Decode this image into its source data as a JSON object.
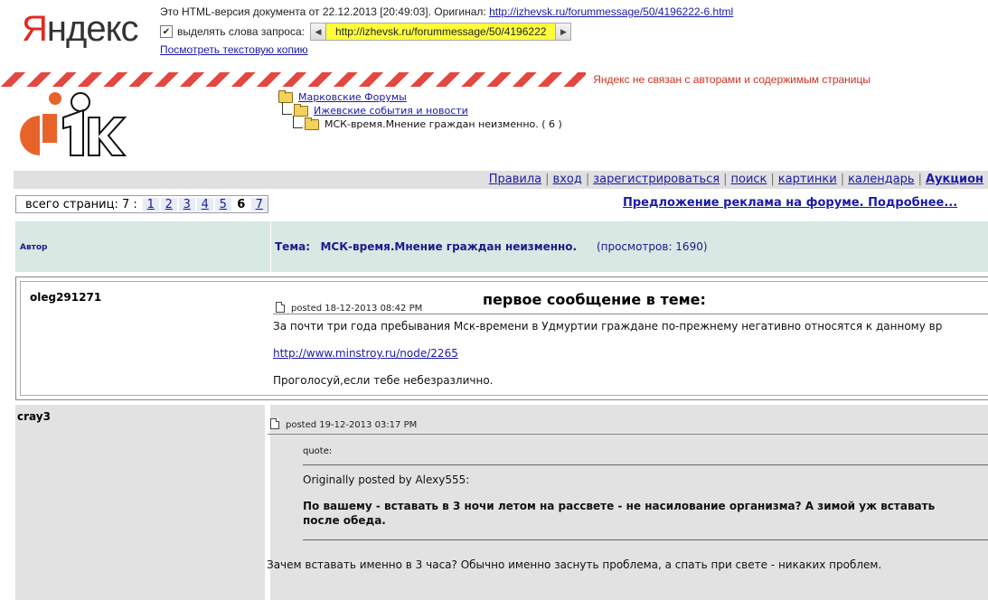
{
  "yandex": {
    "logo_first": "Я",
    "logo_rest": "ндекс",
    "info_prefix": "Это HTML-версия документа от 22.12.2013 [20:49:03]. Оригинал:",
    "original_url": "http://izhevsk.ru/forummessage/50/4196222-6.html",
    "highlight_label": "выделять слова запроса:",
    "highlight_checked": true,
    "query_url": "http://izhevsk.ru/forummessage/50/4196222",
    "text_copy_link": "Посмотреть текстовую копию",
    "disclaimer": "Яндекс не связан с авторами и содержимым страницы",
    "strip_colors": [
      "#ffffff",
      "#e4473f"
    ]
  },
  "breadcrumb": {
    "level1": "Марковские Форумы",
    "level2": "Ижевские события и новости",
    "level3": "МСК-время.Мнение граждан неизменно. ( 6 )"
  },
  "nav": {
    "links": [
      "Правила",
      "вход",
      "зарегистрироваться",
      "поиск",
      "картинки",
      "календарь"
    ],
    "bold_link": "Аукцион"
  },
  "pagination": {
    "label": "всего страниц: 7 :",
    "pages": [
      "1",
      "2",
      "3",
      "4",
      "5",
      "6",
      "7"
    ],
    "current": "6"
  },
  "promo": "Предложение реклама на форуме. Подробнее...",
  "thread": {
    "author_header": "Автор",
    "topic_label": "Тема:",
    "topic_title": "МСК-время.Мнение граждан неизменно.",
    "views": "(просмотров: 1690)"
  },
  "posts": [
    {
      "author": "oleg291271",
      "posted": "posted 18-12-2013 08:42 PM",
      "first_label": "первое сообщение в теме:",
      "body1": "За почти три года пребывания Мск-времени в Удмуртии граждане по-прежнему негативно относятся к данному вр",
      "link": "http://www.minstroy.ru/node/2265",
      "body2": "Проголосуй,если тебе небезразлично."
    },
    {
      "author": "cray3",
      "posted": "posted 19-12-2013 03:17 PM",
      "quote_label": "quote:",
      "quote_by": "Originally posted by Alexy555:",
      "quote_line1": "По вашему - вставать в 3 ночи летом на рассвете - не насилование организма? А зимой уж вставать",
      "quote_line2": "после обеда.",
      "reply": "Зачем вставать именно в 3 часа? Обычно именно заснуть проблема, а спать при свете - никаких проблем."
    }
  ],
  "colors": {
    "link": "#1a1aa6",
    "yandex_red": "#e5291f",
    "url_highlight": "#ffff3c",
    "thread_header_bg": "#d8e8e3",
    "post2_bg": "#e2e2e2",
    "logo_orange": "#e8632a"
  },
  "icons": [
    "checkbox-icon",
    "arrow-left-icon",
    "arrow-right-icon",
    "folder-open-icon",
    "document-icon",
    "forum-logo"
  ]
}
